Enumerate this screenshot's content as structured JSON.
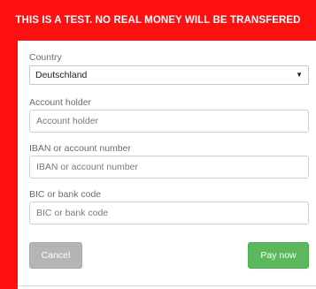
{
  "banner": {
    "text": "THIS IS A TEST. NO REAL MONEY WILL BE TRANSFERED"
  },
  "form": {
    "country": {
      "label": "Country",
      "selected": "Deutschland"
    },
    "account_holder": {
      "label": "Account holder",
      "placeholder": "Account holder",
      "value": ""
    },
    "iban": {
      "label": "IBAN or account number",
      "placeholder": "IBAN or account number",
      "value": ""
    },
    "bic": {
      "label": "BIC or bank code",
      "placeholder": "BIC or bank code",
      "value": ""
    }
  },
  "actions": {
    "cancel_label": "Cancel",
    "pay_label": "Pay now"
  },
  "icons": {
    "select_arrow": "chevron-down-icon"
  },
  "colors": {
    "banner_bg": "#ff1010",
    "pay_button": "#5cb85c",
    "cancel_button": "#b5b5b5"
  }
}
